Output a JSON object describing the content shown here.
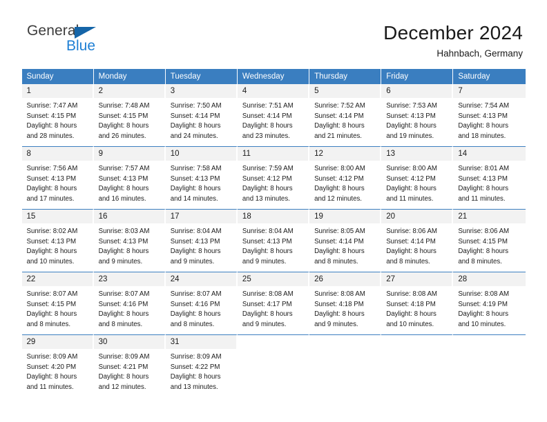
{
  "brand": {
    "name_top": "General",
    "name_bottom": "Blue",
    "flag_color": "#1565a8",
    "blue_color": "#1e7fd4"
  },
  "header": {
    "title": "December 2024",
    "location": "Hahnbach, Germany"
  },
  "theme": {
    "header_bg": "#3a7ec0",
    "daynum_bg": "#f2f2f2",
    "text": "#1a1a1a"
  },
  "weekdays": [
    "Sunday",
    "Monday",
    "Tuesday",
    "Wednesday",
    "Thursday",
    "Friday",
    "Saturday"
  ],
  "weeks": [
    [
      {
        "day": "1",
        "sunrise": "Sunrise: 7:47 AM",
        "sunset": "Sunset: 4:15 PM",
        "daylight1": "Daylight: 8 hours",
        "daylight2": "and 28 minutes."
      },
      {
        "day": "2",
        "sunrise": "Sunrise: 7:48 AM",
        "sunset": "Sunset: 4:15 PM",
        "daylight1": "Daylight: 8 hours",
        "daylight2": "and 26 minutes."
      },
      {
        "day": "3",
        "sunrise": "Sunrise: 7:50 AM",
        "sunset": "Sunset: 4:14 PM",
        "daylight1": "Daylight: 8 hours",
        "daylight2": "and 24 minutes."
      },
      {
        "day": "4",
        "sunrise": "Sunrise: 7:51 AM",
        "sunset": "Sunset: 4:14 PM",
        "daylight1": "Daylight: 8 hours",
        "daylight2": "and 23 minutes."
      },
      {
        "day": "5",
        "sunrise": "Sunrise: 7:52 AM",
        "sunset": "Sunset: 4:14 PM",
        "daylight1": "Daylight: 8 hours",
        "daylight2": "and 21 minutes."
      },
      {
        "day": "6",
        "sunrise": "Sunrise: 7:53 AM",
        "sunset": "Sunset: 4:13 PM",
        "daylight1": "Daylight: 8 hours",
        "daylight2": "and 19 minutes."
      },
      {
        "day": "7",
        "sunrise": "Sunrise: 7:54 AM",
        "sunset": "Sunset: 4:13 PM",
        "daylight1": "Daylight: 8 hours",
        "daylight2": "and 18 minutes."
      }
    ],
    [
      {
        "day": "8",
        "sunrise": "Sunrise: 7:56 AM",
        "sunset": "Sunset: 4:13 PM",
        "daylight1": "Daylight: 8 hours",
        "daylight2": "and 17 minutes."
      },
      {
        "day": "9",
        "sunrise": "Sunrise: 7:57 AM",
        "sunset": "Sunset: 4:13 PM",
        "daylight1": "Daylight: 8 hours",
        "daylight2": "and 16 minutes."
      },
      {
        "day": "10",
        "sunrise": "Sunrise: 7:58 AM",
        "sunset": "Sunset: 4:13 PM",
        "daylight1": "Daylight: 8 hours",
        "daylight2": "and 14 minutes."
      },
      {
        "day": "11",
        "sunrise": "Sunrise: 7:59 AM",
        "sunset": "Sunset: 4:12 PM",
        "daylight1": "Daylight: 8 hours",
        "daylight2": "and 13 minutes."
      },
      {
        "day": "12",
        "sunrise": "Sunrise: 8:00 AM",
        "sunset": "Sunset: 4:12 PM",
        "daylight1": "Daylight: 8 hours",
        "daylight2": "and 12 minutes."
      },
      {
        "day": "13",
        "sunrise": "Sunrise: 8:00 AM",
        "sunset": "Sunset: 4:12 PM",
        "daylight1": "Daylight: 8 hours",
        "daylight2": "and 11 minutes."
      },
      {
        "day": "14",
        "sunrise": "Sunrise: 8:01 AM",
        "sunset": "Sunset: 4:13 PM",
        "daylight1": "Daylight: 8 hours",
        "daylight2": "and 11 minutes."
      }
    ],
    [
      {
        "day": "15",
        "sunrise": "Sunrise: 8:02 AM",
        "sunset": "Sunset: 4:13 PM",
        "daylight1": "Daylight: 8 hours",
        "daylight2": "and 10 minutes."
      },
      {
        "day": "16",
        "sunrise": "Sunrise: 8:03 AM",
        "sunset": "Sunset: 4:13 PM",
        "daylight1": "Daylight: 8 hours",
        "daylight2": "and 9 minutes."
      },
      {
        "day": "17",
        "sunrise": "Sunrise: 8:04 AM",
        "sunset": "Sunset: 4:13 PM",
        "daylight1": "Daylight: 8 hours",
        "daylight2": "and 9 minutes."
      },
      {
        "day": "18",
        "sunrise": "Sunrise: 8:04 AM",
        "sunset": "Sunset: 4:13 PM",
        "daylight1": "Daylight: 8 hours",
        "daylight2": "and 9 minutes."
      },
      {
        "day": "19",
        "sunrise": "Sunrise: 8:05 AM",
        "sunset": "Sunset: 4:14 PM",
        "daylight1": "Daylight: 8 hours",
        "daylight2": "and 8 minutes."
      },
      {
        "day": "20",
        "sunrise": "Sunrise: 8:06 AM",
        "sunset": "Sunset: 4:14 PM",
        "daylight1": "Daylight: 8 hours",
        "daylight2": "and 8 minutes."
      },
      {
        "day": "21",
        "sunrise": "Sunrise: 8:06 AM",
        "sunset": "Sunset: 4:15 PM",
        "daylight1": "Daylight: 8 hours",
        "daylight2": "and 8 minutes."
      }
    ],
    [
      {
        "day": "22",
        "sunrise": "Sunrise: 8:07 AM",
        "sunset": "Sunset: 4:15 PM",
        "daylight1": "Daylight: 8 hours",
        "daylight2": "and 8 minutes."
      },
      {
        "day": "23",
        "sunrise": "Sunrise: 8:07 AM",
        "sunset": "Sunset: 4:16 PM",
        "daylight1": "Daylight: 8 hours",
        "daylight2": "and 8 minutes."
      },
      {
        "day": "24",
        "sunrise": "Sunrise: 8:07 AM",
        "sunset": "Sunset: 4:16 PM",
        "daylight1": "Daylight: 8 hours",
        "daylight2": "and 8 minutes."
      },
      {
        "day": "25",
        "sunrise": "Sunrise: 8:08 AM",
        "sunset": "Sunset: 4:17 PM",
        "daylight1": "Daylight: 8 hours",
        "daylight2": "and 9 minutes."
      },
      {
        "day": "26",
        "sunrise": "Sunrise: 8:08 AM",
        "sunset": "Sunset: 4:18 PM",
        "daylight1": "Daylight: 8 hours",
        "daylight2": "and 9 minutes."
      },
      {
        "day": "27",
        "sunrise": "Sunrise: 8:08 AM",
        "sunset": "Sunset: 4:18 PM",
        "daylight1": "Daylight: 8 hours",
        "daylight2": "and 10 minutes."
      },
      {
        "day": "28",
        "sunrise": "Sunrise: 8:08 AM",
        "sunset": "Sunset: 4:19 PM",
        "daylight1": "Daylight: 8 hours",
        "daylight2": "and 10 minutes."
      }
    ],
    [
      {
        "day": "29",
        "sunrise": "Sunrise: 8:09 AM",
        "sunset": "Sunset: 4:20 PM",
        "daylight1": "Daylight: 8 hours",
        "daylight2": "and 11 minutes."
      },
      {
        "day": "30",
        "sunrise": "Sunrise: 8:09 AM",
        "sunset": "Sunset: 4:21 PM",
        "daylight1": "Daylight: 8 hours",
        "daylight2": "and 12 minutes."
      },
      {
        "day": "31",
        "sunrise": "Sunrise: 8:09 AM",
        "sunset": "Sunset: 4:22 PM",
        "daylight1": "Daylight: 8 hours",
        "daylight2": "and 13 minutes."
      },
      {
        "day": "",
        "sunrise": "",
        "sunset": "",
        "daylight1": "",
        "daylight2": ""
      },
      {
        "day": "",
        "sunrise": "",
        "sunset": "",
        "daylight1": "",
        "daylight2": ""
      },
      {
        "day": "",
        "sunrise": "",
        "sunset": "",
        "daylight1": "",
        "daylight2": ""
      },
      {
        "day": "",
        "sunrise": "",
        "sunset": "",
        "daylight1": "",
        "daylight2": ""
      }
    ]
  ]
}
